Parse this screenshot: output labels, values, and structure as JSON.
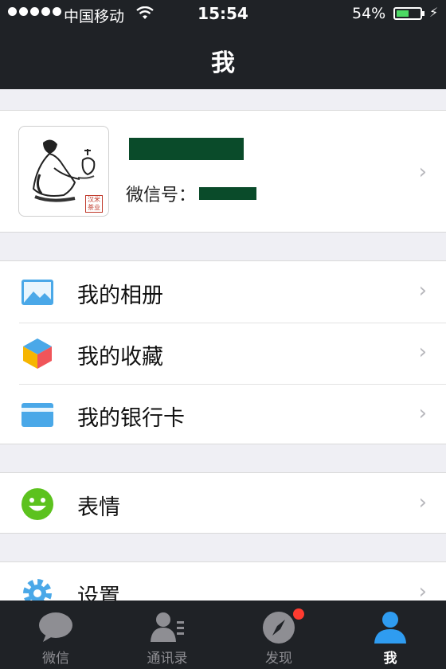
{
  "status_bar": {
    "carrier": "中国移动",
    "time": "15:54",
    "battery": "54%",
    "battery_level": 0.54
  },
  "nav": {
    "title": "我"
  },
  "profile": {
    "wechat_id_label": "微信号：",
    "seal_text": "汉米茶业"
  },
  "menu_groups": [
    {
      "items": [
        {
          "label": "我的相册",
          "icon": "photo-album-icon"
        },
        {
          "label": "我的收藏",
          "icon": "favorites-cube-icon"
        },
        {
          "label": "我的银行卡",
          "icon": "bank-card-icon"
        }
      ]
    },
    {
      "items": [
        {
          "label": "表情",
          "icon": "smiley-icon"
        }
      ]
    },
    {
      "items": [
        {
          "label": "设置",
          "icon": "settings-gear-icon"
        }
      ]
    }
  ],
  "tabs": [
    {
      "label": "微信",
      "icon": "chat-bubble-icon",
      "active": false
    },
    {
      "label": "通讯录",
      "icon": "contacts-icon",
      "active": false
    },
    {
      "label": "发现",
      "icon": "compass-icon",
      "active": false,
      "badge": true
    },
    {
      "label": "我",
      "icon": "person-icon",
      "active": true
    }
  ],
  "colors": {
    "bar_background": "#1f2226",
    "page_background": "#efeff4",
    "battery_green": "#4cd964",
    "active_tab": "#1aad19",
    "badge_red": "#ff3b30"
  }
}
